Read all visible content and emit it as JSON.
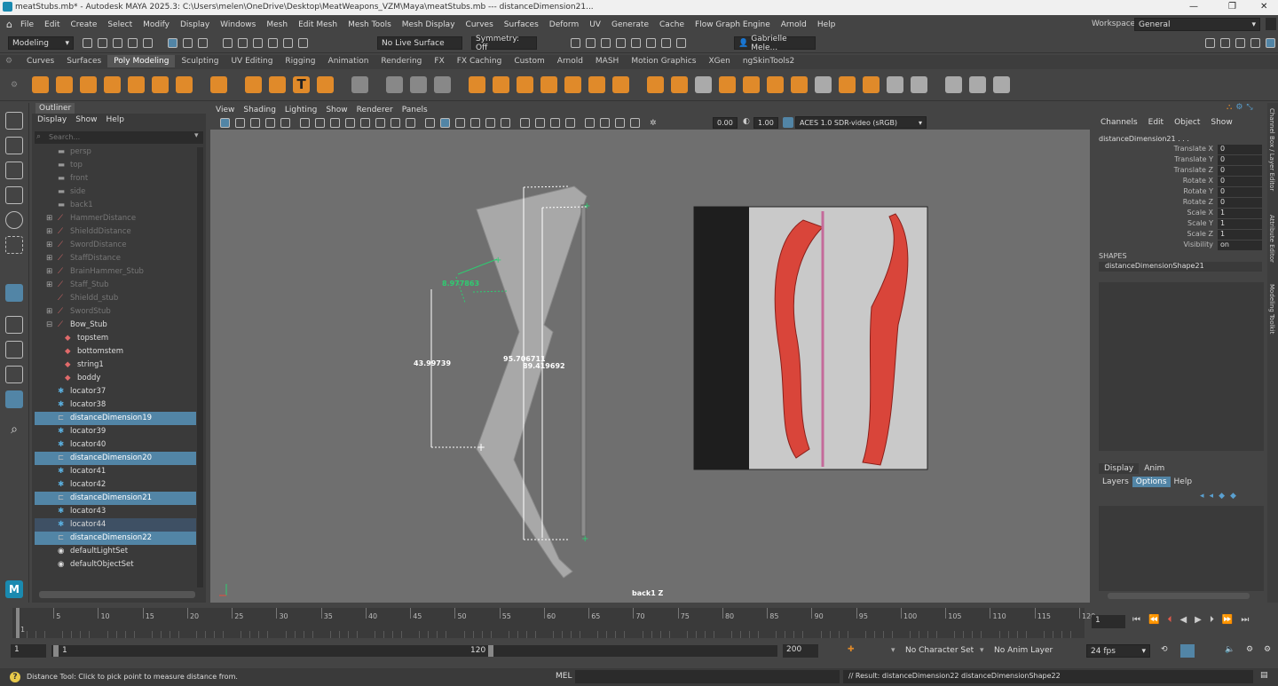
{
  "window": {
    "title": "meatStubs.mb* - Autodesk MAYA 2025.3: C:\\Users\\melen\\OneDrive\\Desktop\\MeatWeapons_VZM\\Maya\\meatStubs.mb  ---  distanceDimension21..."
  },
  "menu": [
    "File",
    "Edit",
    "Create",
    "Select",
    "Modify",
    "Display",
    "Windows",
    "Mesh",
    "Edit Mesh",
    "Mesh Tools",
    "Mesh Display",
    "Curves",
    "Surfaces",
    "Deform",
    "UV",
    "Generate",
    "Cache",
    "Flow Graph Engine",
    "Arnold",
    "Help"
  ],
  "workspace": {
    "label": "Workspace:",
    "value": "General"
  },
  "toolbar": {
    "mode": "Modeling",
    "live_surface": "No Live Surface",
    "symmetry": "Symmetry: Off",
    "user": "Gabrielle Mele..."
  },
  "shelf_tabs": [
    "Curves",
    "Surfaces",
    "Poly Modeling",
    "Sculpting",
    "UV Editing",
    "Rigging",
    "Animation",
    "Rendering",
    "FX",
    "FX Caching",
    "Custom",
    "Arnold",
    "MASH",
    "Motion Graphics",
    "XGen",
    "ngSkinTools2"
  ],
  "shelf_active": "Poly Modeling",
  "outliner": {
    "title": "Outliner",
    "menu": [
      "Display",
      "Show",
      "Help"
    ],
    "search_placeholder": "Search...",
    "items": [
      {
        "label": "persp",
        "style": "dim"
      },
      {
        "label": "top",
        "style": "dim"
      },
      {
        "label": "front",
        "style": "dim"
      },
      {
        "label": "side",
        "style": "dim"
      },
      {
        "label": "back1",
        "style": "dim"
      },
      {
        "label": "HammerDistance",
        "style": "dim"
      },
      {
        "label": "ShielddDistance",
        "style": "dim"
      },
      {
        "label": "SwordDistance",
        "style": "dim"
      },
      {
        "label": "StaffDistance",
        "style": "dim"
      },
      {
        "label": "BrainHammer_Stub",
        "style": "dim"
      },
      {
        "label": "Staff_Stub",
        "style": "dim"
      },
      {
        "label": "Shieldd_stub",
        "style": "dim"
      },
      {
        "label": "SwordStub",
        "style": "dim"
      },
      {
        "label": "Bow_Stub",
        "style": "normal"
      },
      {
        "label": "topstem",
        "style": "normal"
      },
      {
        "label": "bottomstem",
        "style": "normal"
      },
      {
        "label": "string1",
        "style": "normal"
      },
      {
        "label": "boddy",
        "style": "normal"
      },
      {
        "label": "locator37",
        "style": "normal"
      },
      {
        "label": "locator38",
        "style": "normal"
      },
      {
        "label": "distanceDimension19",
        "style": "sel"
      },
      {
        "label": "locator39",
        "style": "normal"
      },
      {
        "label": "locator40",
        "style": "normal"
      },
      {
        "label": "distanceDimension20",
        "style": "sel"
      },
      {
        "label": "locator41",
        "style": "normal"
      },
      {
        "label": "locator42",
        "style": "normal"
      },
      {
        "label": "distanceDimension21",
        "style": "sel"
      },
      {
        "label": "locator43",
        "style": "normal"
      },
      {
        "label": "locator44",
        "style": "hl"
      },
      {
        "label": "distanceDimension22",
        "style": "sel"
      },
      {
        "label": "defaultLightSet",
        "style": "normal"
      },
      {
        "label": "defaultObjectSet",
        "style": "normal"
      }
    ]
  },
  "viewport": {
    "menu": [
      "View",
      "Shading",
      "Lighting",
      "Show",
      "Renderer",
      "Panels"
    ],
    "near": "0.00",
    "far": "1.00",
    "colorspace": "ACES 1.0 SDR-video (sRGB)",
    "camera": "back1 Z",
    "dimensions": {
      "d1": "8.977863",
      "d2": "43.99739",
      "d3": "95.706711",
      "d4": "89.419692"
    }
  },
  "channel_box": {
    "menu": [
      "Channels",
      "Edit",
      "Object",
      "Show"
    ],
    "object": "distanceDimension21 . . .",
    "attrs": [
      {
        "name": "Translate X",
        "value": "0"
      },
      {
        "name": "Translate Y",
        "value": "0"
      },
      {
        "name": "Translate Z",
        "value": "0"
      },
      {
        "name": "Rotate X",
        "value": "0"
      },
      {
        "name": "Rotate Y",
        "value": "0"
      },
      {
        "name": "Rotate Z",
        "value": "0"
      },
      {
        "name": "Scale X",
        "value": "1"
      },
      {
        "name": "Scale Y",
        "value": "1"
      },
      {
        "name": "Scale Z",
        "value": "1"
      },
      {
        "name": "Visibility",
        "value": "on"
      }
    ],
    "shapes_label": "SHAPES",
    "shape": "distanceDimensionShape21",
    "side_tabs": [
      "Channel Box / Layer Editor",
      "Attribute Editor",
      "Modeling Toolkit"
    ]
  },
  "layer_editor": {
    "tabs": [
      "Display",
      "Anim"
    ],
    "menu": [
      "Layers",
      "Options",
      "Help"
    ],
    "active": "Options"
  },
  "timeline": {
    "ticks": [
      "1",
      "5",
      "10",
      "15",
      "20",
      "25",
      "30",
      "35",
      "40",
      "45",
      "50",
      "55",
      "60",
      "65",
      "70",
      "75",
      "80",
      "85",
      "90",
      "95",
      "100",
      "105",
      "110",
      "115",
      "120"
    ],
    "current": "1"
  },
  "range": {
    "start": "1",
    "start_inner": "1",
    "end_inner": "120",
    "end": "200",
    "char_set": "No Character Set",
    "anim_layer": "No Anim Layer",
    "fps": "24 fps"
  },
  "command": {
    "lang": "MEL",
    "result": "// Result: distanceDimension22 distanceDimensionShape22"
  },
  "help_line": "Distance Tool: Click to pick point to measure distance from."
}
